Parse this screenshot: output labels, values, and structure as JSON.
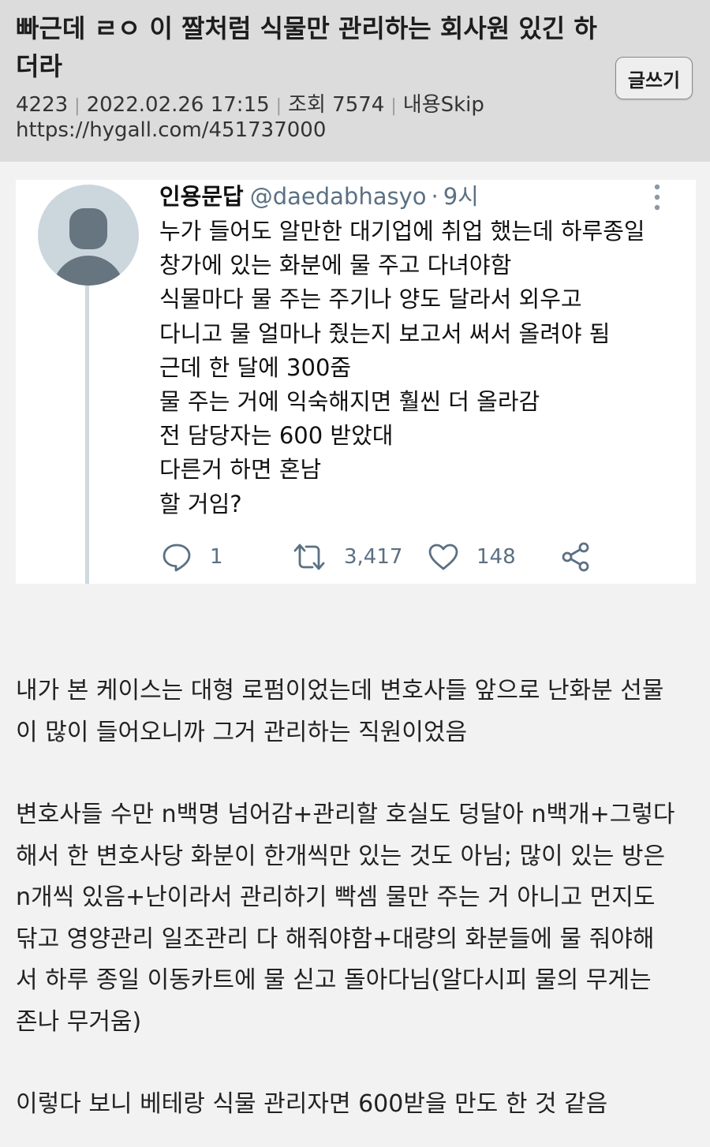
{
  "post": {
    "title": "빠근데 ㄹㅇ 이 짤처럼 식물만 관리하는 회사원 있긴 하더라",
    "number": "4223",
    "datetime": "2022.02.26 17:15",
    "views_label": "조회 7574",
    "skip_label": "내용Skip",
    "url": "https://hygall.com/451737000",
    "write_button": "글쓰기"
  },
  "tweet": {
    "name": "인용문답",
    "handle": "@daedabhasyo",
    "dot": "·",
    "time": "9시",
    "lines": [
      "누가 들어도 알만한 대기업에 취업 했는데 하루종일",
      "창가에 있는 화분에 물 주고 다녀야함",
      "식물마다 물 주는 주기나 양도 달라서 외우고",
      "다니고 물 얼마나 줬는지 보고서 써서 올려야 됨",
      "근데 한 달에 300줌",
      "물 주는 거에 익숙해지면 훨씬 더 올라감",
      "전 담당자는 600 받았대",
      "다른거 하면 혼남",
      "할 거임?"
    ],
    "replies": "1",
    "retweets": "3,417",
    "likes": "148"
  },
  "body": {
    "para1": [
      "내가 본 케이스는 대형 로펌이었는데 변호사들 앞으로 난화분 선물",
      "이 많이 들어오니까 그거 관리하는 직원이었음"
    ],
    "para2": [
      "변호사들 수만 n백명 넘어감+관리할 호실도 덩달아 n백개+그렇다",
      "해서 한 변호사당 화분이 한개씩만 있는 것도 아님; 많이 있는 방은",
      "n개씩 있음+난이라서 관리하기 빡셈 물만 주는 거 아니고 먼지도",
      "닦고 영양관리 일조관리 다 해줘야함+대량의 화분들에 물 줘야해",
      "서 하루 종일 이동카트에 물 싣고 돌아다님(알다시피 물의 무게는",
      "존나 무거움)"
    ],
    "para3": [
      "이렇다 보니 베테랑 식물 관리자면 600받을 만도 한 것 같음"
    ]
  },
  "colors": {
    "header_bg": "#dcdcdc",
    "page_bg": "#f2f2f2",
    "tweet_bg": "#ffffff",
    "tweet_muted": "#5b7083",
    "thread_line": "#cfd9de"
  }
}
